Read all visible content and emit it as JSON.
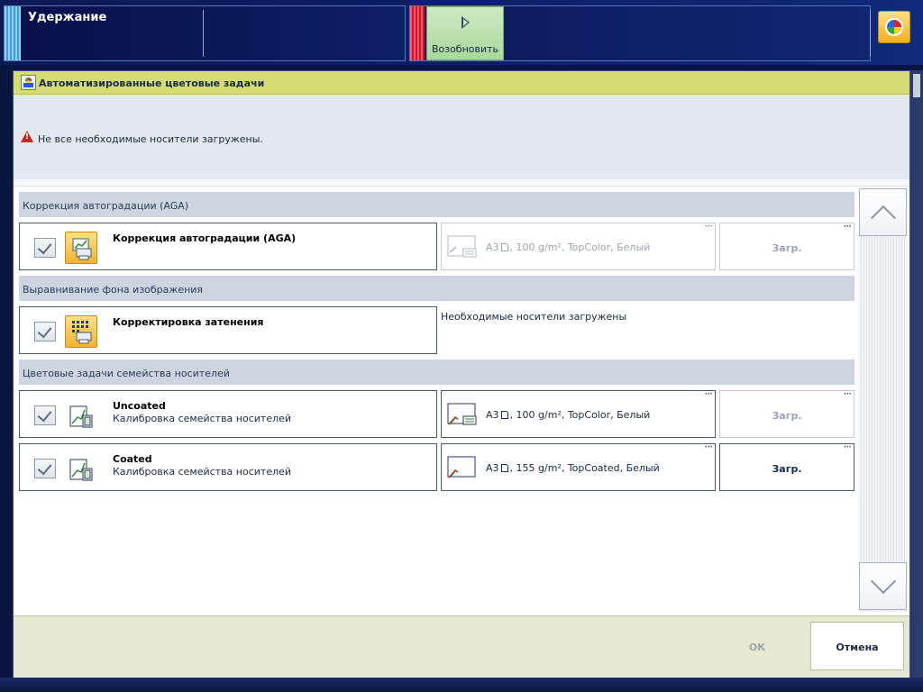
{
  "topbar": {
    "status_title": "Удержание",
    "resume_label": "Возобновить"
  },
  "dialog": {
    "title": "Автоматизированные цветовые задачи",
    "warning": "Не все необходимые носители загружены.",
    "sections": [
      {
        "header": "Коррекция автоградации (AGA)"
      },
      {
        "header": "Выравнивание фона изображения"
      },
      {
        "header": "Цветовые задачи семейства носителей"
      }
    ],
    "tasks": [
      {
        "title": "Коррекция автоградации (AGA)",
        "subtitle": "",
        "media": "А3",
        "media_details": ", 100 g/m², TopColor, Белый",
        "load_label": "Загр.",
        "load_enabled": false
      },
      {
        "title": "Корректировка затенения",
        "subtitle": "",
        "status": "Необходимые носители загружены"
      },
      {
        "title": "Uncoated",
        "subtitle": "Калибровка семейства носителей",
        "media": "А3",
        "media_details": ", 100 g/m², TopColor, Белый",
        "load_label": "Загр.",
        "load_enabled": false
      },
      {
        "title": "Coated",
        "subtitle": "Калибровка семейства носителей",
        "media": "А3",
        "media_details": ", 155 g/m², TopCoated, Белый",
        "load_label": "Загр.",
        "load_enabled": true
      }
    ],
    "footer": {
      "ok_label": "ОК",
      "cancel_label": "Отмена"
    }
  }
}
